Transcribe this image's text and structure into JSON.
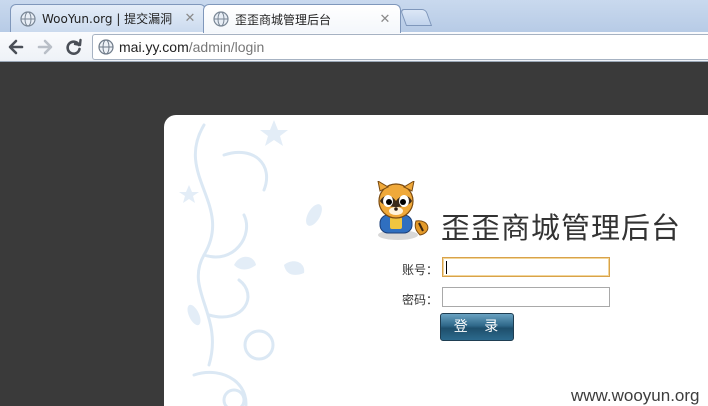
{
  "browser": {
    "tabs": [
      {
        "title": "WooYun.org | 提交漏洞",
        "active": false
      },
      {
        "title": "歪歪商城管理后台",
        "active": true
      }
    ],
    "url_host": "mai.yy.com",
    "url_path": "/admin/login"
  },
  "icons": {
    "back": "arrow-left-icon",
    "forward": "arrow-right-icon",
    "reload": "reload-icon",
    "page": "globe-icon",
    "close": "close-icon",
    "mascot": "raccoon-mascot"
  },
  "login": {
    "site_title": "歪歪商城管理后台",
    "username_label": "账号：",
    "password_label": "密码：",
    "username_value": "",
    "password_value": "",
    "submit_label": "登 录"
  },
  "watermark": "www.wooyun.org",
  "colors": {
    "tab_strip": "#c4d6ee",
    "page_background": "#3a3a3a",
    "button": "#2c6a8d",
    "focus_border": "#d9a24a"
  }
}
